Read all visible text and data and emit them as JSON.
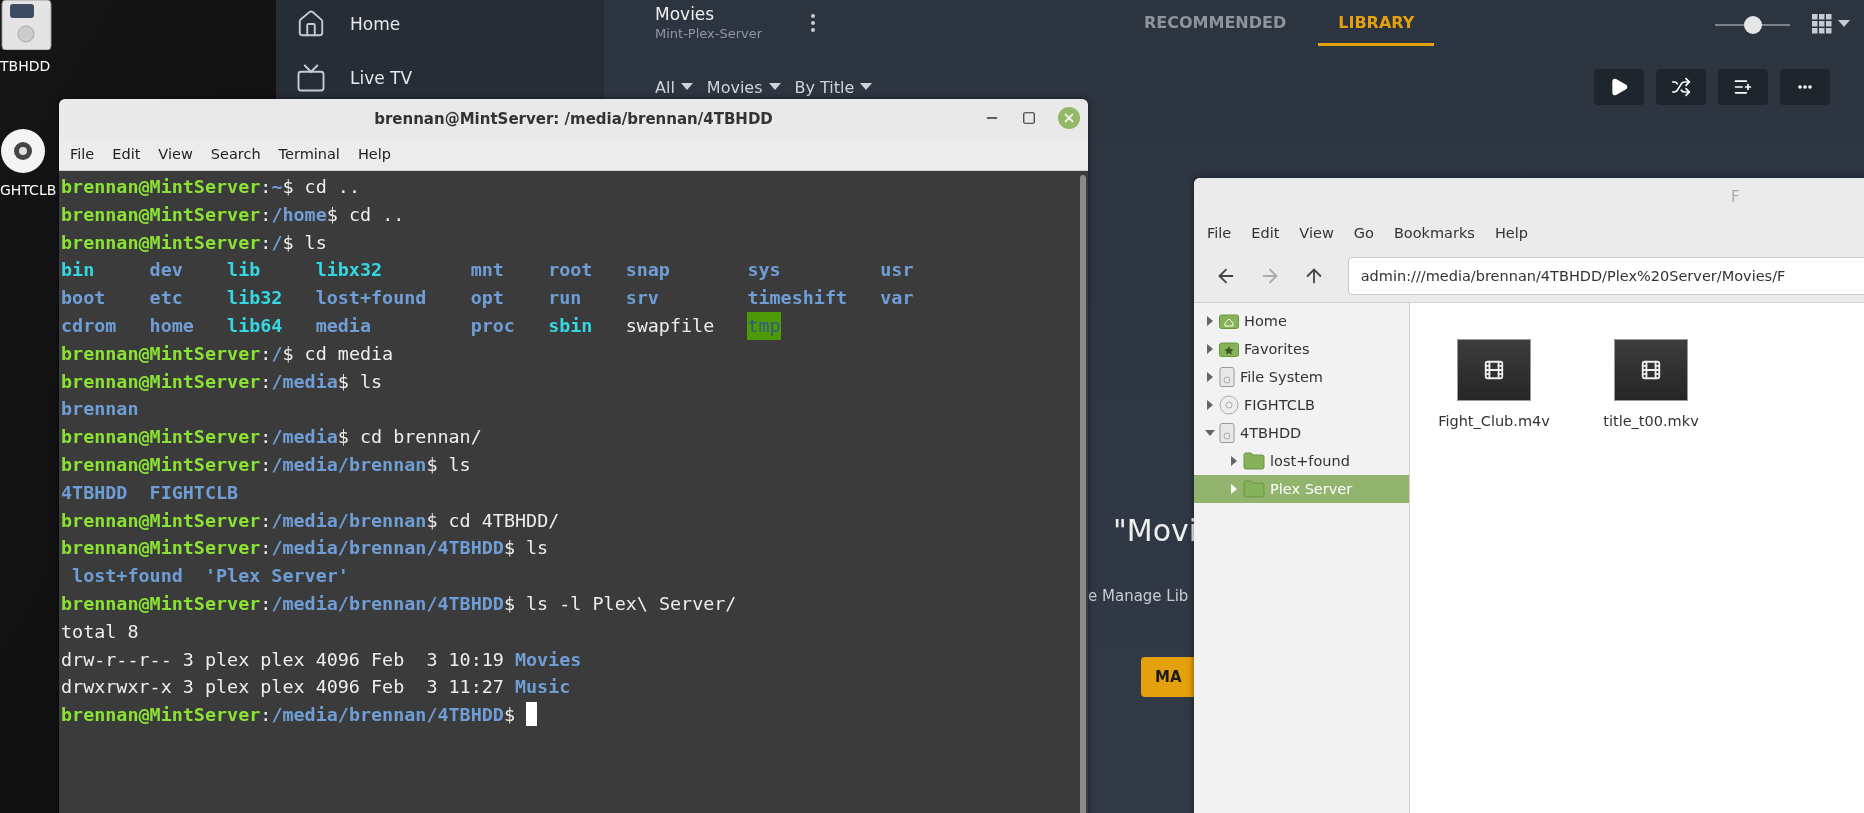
{
  "desktop": {
    "icons": [
      {
        "label": "TBHDD",
        "kind": "drive"
      },
      {
        "label": "GHTCLB",
        "kind": "disc"
      }
    ]
  },
  "plex": {
    "sidebar": {
      "items": [
        {
          "label": "Home",
          "kind": "home"
        },
        {
          "label": "Live TV",
          "kind": "tv"
        }
      ]
    },
    "header": {
      "title": "Movies",
      "server": "Mint-Plex-Server",
      "filters": [
        "All",
        "Movies",
        "By Title"
      ],
      "tabs": [
        {
          "label": "RECOMMENDED",
          "selected": false
        },
        {
          "label": "LIBRARY",
          "selected": true
        }
      ],
      "size_slider": {
        "level": 0.5
      },
      "actions": [
        {
          "kind": "play"
        },
        {
          "kind": "shuffle"
        },
        {
          "kind": "queue"
        },
        {
          "kind": "more"
        }
      ]
    },
    "empty_state": {
      "heading": "\"Movi",
      "subtext": "e Manage Lib",
      "button": "MA"
    }
  },
  "terminal": {
    "title": "brennan@MintServer: /media/brennan/4TBHDD",
    "menu": [
      "File",
      "Edit",
      "View",
      "Search",
      "Terminal",
      "Help"
    ],
    "lines": [
      {
        "kind": "text",
        "segments": [
          {
            "kind": "user",
            "text": "brennan@MintServer"
          },
          {
            "kind": "plain",
            "text": ":"
          },
          {
            "kind": "path",
            "text": "~"
          },
          {
            "kind": "plain",
            "text": "$ cd .."
          }
        ]
      },
      {
        "kind": "text",
        "segments": [
          {
            "kind": "user",
            "text": "brennan@MintServer"
          },
          {
            "kind": "plain",
            "text": ":"
          },
          {
            "kind": "path",
            "text": "/home"
          },
          {
            "kind": "plain",
            "text": "$ cd .."
          }
        ]
      },
      {
        "kind": "text",
        "segments": [
          {
            "kind": "user",
            "text": "brennan@MintServer"
          },
          {
            "kind": "plain",
            "text": ":"
          },
          {
            "kind": "path",
            "text": "/"
          },
          {
            "kind": "plain",
            "text": "$ ls"
          }
        ]
      },
      {
        "kind": "grid",
        "cells": [
          {
            "kind": "link",
            "text": "bin"
          },
          {
            "kind": "dir",
            "text": "dev"
          },
          {
            "kind": "link",
            "text": "lib"
          },
          {
            "kind": "link",
            "text": "libx32"
          },
          {
            "kind": "dir",
            "text": "mnt"
          },
          {
            "kind": "dir",
            "text": "root"
          },
          {
            "kind": "dir",
            "text": "snap"
          },
          {
            "kind": "dir",
            "text": "sys"
          },
          {
            "kind": "dir",
            "text": "usr"
          }
        ]
      },
      {
        "kind": "grid",
        "cells": [
          {
            "kind": "dir",
            "text": "boot"
          },
          {
            "kind": "dir",
            "text": "etc"
          },
          {
            "kind": "link",
            "text": "lib32"
          },
          {
            "kind": "dir",
            "text": "lost+found"
          },
          {
            "kind": "dir",
            "text": "opt"
          },
          {
            "kind": "dir",
            "text": "run"
          },
          {
            "kind": "dir",
            "text": "srv"
          },
          {
            "kind": "dir",
            "text": "timeshift"
          },
          {
            "kind": "dir",
            "text": "var"
          }
        ]
      },
      {
        "kind": "grid",
        "cells": [
          {
            "kind": "dir",
            "text": "cdrom"
          },
          {
            "kind": "dir",
            "text": "home"
          },
          {
            "kind": "link",
            "text": "lib64"
          },
          {
            "kind": "dir",
            "text": "media"
          },
          {
            "kind": "dir",
            "text": "proc"
          },
          {
            "kind": "link",
            "text": "sbin"
          },
          {
            "kind": "plain",
            "text": "swapfile"
          },
          {
            "kind": "sticky",
            "text": "tmp"
          }
        ]
      },
      {
        "kind": "text",
        "segments": [
          {
            "kind": "user",
            "text": "brennan@MintServer"
          },
          {
            "kind": "plain",
            "text": ":"
          },
          {
            "kind": "path",
            "text": "/"
          },
          {
            "kind": "plain",
            "text": "$ cd media"
          }
        ]
      },
      {
        "kind": "text",
        "segments": [
          {
            "kind": "user",
            "text": "brennan@MintServer"
          },
          {
            "kind": "plain",
            "text": ":"
          },
          {
            "kind": "path",
            "text": "/media"
          },
          {
            "kind": "plain",
            "text": "$ ls"
          }
        ]
      },
      {
        "kind": "text",
        "segments": [
          {
            "kind": "dir",
            "text": "brennan"
          }
        ]
      },
      {
        "kind": "text",
        "segments": [
          {
            "kind": "user",
            "text": "brennan@MintServer"
          },
          {
            "kind": "plain",
            "text": ":"
          },
          {
            "kind": "path",
            "text": "/media"
          },
          {
            "kind": "plain",
            "text": "$ cd brennan/"
          }
        ]
      },
      {
        "kind": "text",
        "segments": [
          {
            "kind": "user",
            "text": "brennan@MintServer"
          },
          {
            "kind": "plain",
            "text": ":"
          },
          {
            "kind": "path",
            "text": "/media/brennan"
          },
          {
            "kind": "plain",
            "text": "$ ls"
          }
        ]
      },
      {
        "kind": "text",
        "segments": [
          {
            "kind": "dir",
            "text": "4TBHDD  FIGHTCLB"
          }
        ]
      },
      {
        "kind": "text",
        "segments": [
          {
            "kind": "user",
            "text": "brennan@MintServer"
          },
          {
            "kind": "plain",
            "text": ":"
          },
          {
            "kind": "path",
            "text": "/media/brennan"
          },
          {
            "kind": "plain",
            "text": "$ cd 4TBHDD/"
          }
        ]
      },
      {
        "kind": "text",
        "segments": [
          {
            "kind": "user",
            "text": "brennan@MintServer"
          },
          {
            "kind": "plain",
            "text": ":"
          },
          {
            "kind": "path",
            "text": "/media/brennan/4TBHDD"
          },
          {
            "kind": "plain",
            "text": "$ ls"
          }
        ]
      },
      {
        "kind": "text",
        "segments": [
          {
            "kind": "dir",
            "text": " lost+found  'Plex Server'"
          }
        ]
      },
      {
        "kind": "text",
        "segments": [
          {
            "kind": "user",
            "text": "brennan@MintServer"
          },
          {
            "kind": "plain",
            "text": ":"
          },
          {
            "kind": "path",
            "text": "/media/brennan/4TBHDD"
          },
          {
            "kind": "plain",
            "text": "$ ls -l Plex\\ Server/"
          }
        ]
      },
      {
        "kind": "text",
        "segments": [
          {
            "kind": "plain",
            "text": "total 8"
          }
        ]
      },
      {
        "kind": "text",
        "segments": [
          {
            "kind": "plain",
            "text": "drw-r--r-- 3 plex plex 4096 Feb  3 10:19 "
          },
          {
            "kind": "dir",
            "text": "Movies"
          }
        ]
      },
      {
        "kind": "text",
        "segments": [
          {
            "kind": "plain",
            "text": "drwxrwxr-x 3 plex plex 4096 Feb  3 11:27 "
          },
          {
            "kind": "dir",
            "text": "Music"
          }
        ]
      },
      {
        "kind": "text",
        "cursor": true,
        "segments": [
          {
            "kind": "user",
            "text": "brennan@MintServer"
          },
          {
            "kind": "plain",
            "text": ":"
          },
          {
            "kind": "path",
            "text": "/media/brennan/4TBHDD"
          },
          {
            "kind": "plain",
            "text": "$"
          }
        ]
      }
    ]
  },
  "file_manager": {
    "title": "F",
    "menu": [
      "File",
      "Edit",
      "View",
      "Go",
      "Bookmarks",
      "Help"
    ],
    "nav": [
      {
        "kind": "back",
        "disabled": false
      },
      {
        "kind": "forward",
        "disabled": true
      },
      {
        "kind": "up",
        "disabled": false
      }
    ],
    "address": "admin:///media/brennan/4TBHDD/Plex%20Server/Movies/F",
    "tree": [
      {
        "label": "Home",
        "kind": "home",
        "expanded": false,
        "selected": false
      },
      {
        "label": "Favorites",
        "kind": "favorites",
        "expanded": false,
        "selected": false
      },
      {
        "label": "File System",
        "kind": "drive",
        "expanded": false,
        "selected": false
      },
      {
        "label": "FIGHTCLB",
        "kind": "disc",
        "expanded": false,
        "selected": false
      },
      {
        "label": "4TBHDD",
        "kind": "drive",
        "expanded": true,
        "selected": false,
        "children": [
          {
            "label": "lost+found",
            "kind": "folder",
            "expanded": false,
            "selected": false
          },
          {
            "label": "Plex Server",
            "kind": "folder",
            "expanded": false,
            "selected": true
          }
        ]
      }
    ],
    "files": [
      {
        "name": "Fight_Club.m4v",
        "kind": "video"
      },
      {
        "name": "title_t00.mkv",
        "kind": "video"
      }
    ]
  }
}
